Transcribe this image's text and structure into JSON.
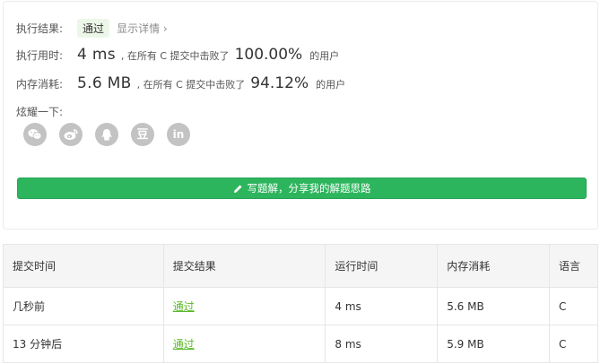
{
  "result": {
    "status_label": "执行结果:",
    "status_value": "通过",
    "detail_link": "显示详情 ›"
  },
  "runtime": {
    "label": "执行用时:",
    "value": "4 ms",
    "beat_prefix": ", 在所有 C 提交中击败了",
    "percent": "100.00%",
    "suffix": "的用户"
  },
  "memory": {
    "label": "内存消耗:",
    "value": "5.6 MB",
    "beat_prefix": ", 在所有 C 提交中击败了",
    "percent": "94.12%",
    "suffix": "的用户"
  },
  "share": {
    "label": "炫耀一下:",
    "icons": [
      "wechat-icon",
      "weibo-icon",
      "qq-icon",
      "douban-icon",
      "linkedin-icon"
    ],
    "douban_glyph": "豆",
    "linkedin_glyph": "in"
  },
  "write_button": {
    "label": "写题解，分享我的解题思路"
  },
  "table": {
    "headers": [
      "提交时间",
      "提交结果",
      "运行时间",
      "内存消耗",
      "语言"
    ],
    "rows": [
      [
        "几秒前",
        "通过",
        "4 ms",
        "5.6 MB",
        "C"
      ],
      [
        "13 分钟后",
        "通过",
        "8 ms",
        "5.9 MB",
        "C"
      ]
    ]
  },
  "colors": {
    "accent_green": "#2db55d",
    "pass_green": "#5ab828",
    "icon_gray": "#c3c3c3"
  }
}
